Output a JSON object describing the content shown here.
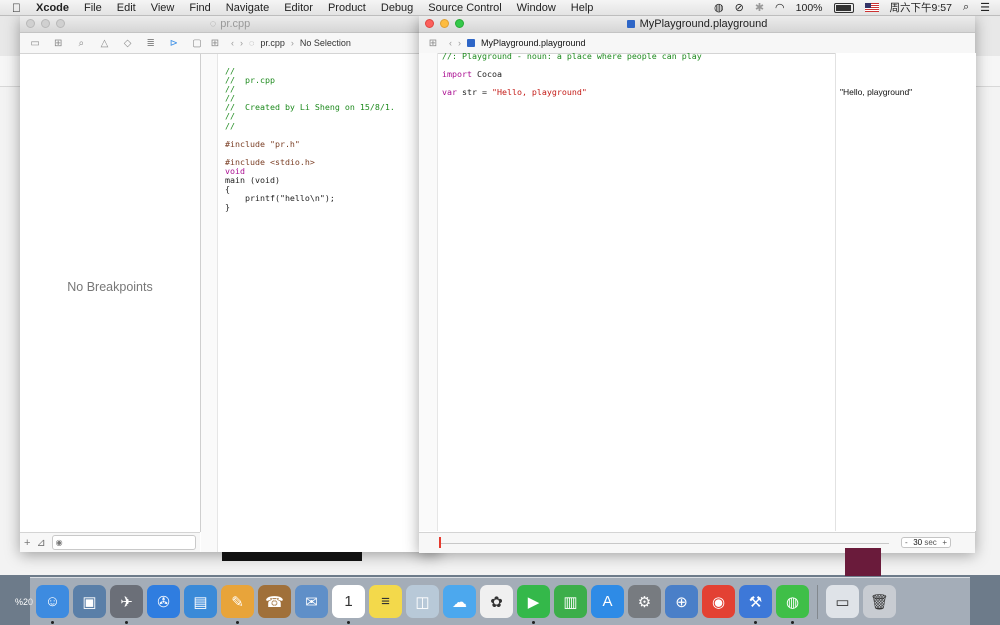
{
  "menubar": {
    "app": "Xcode",
    "items": [
      "File",
      "Edit",
      "View",
      "Find",
      "Navigate",
      "Editor",
      "Product",
      "Debug",
      "Source Control",
      "Window",
      "Help"
    ],
    "battery": "100%",
    "clock": "周六下午9:57"
  },
  "back_window": {
    "title": "pr.cpp",
    "navigator_empty": "No Breakpoints",
    "jump_file": "pr.cpp",
    "jump_selection": "No Selection",
    "code": [
      {
        "cls": "cm",
        "text": "//"
      },
      {
        "cls": "cm",
        "text": "//  pr.cpp"
      },
      {
        "cls": "cm",
        "text": "//"
      },
      {
        "cls": "cm",
        "text": "//"
      },
      {
        "cls": "cm",
        "text": "//  Created by Li Sheng on 15/8/1."
      },
      {
        "cls": "cm",
        "text": "//"
      },
      {
        "cls": "cm",
        "text": "//"
      },
      {
        "cls": "",
        "text": ""
      },
      {
        "cls": "pp",
        "text": "#include \"pr.h\""
      },
      {
        "cls": "",
        "text": ""
      },
      {
        "cls": "pp",
        "text": "#include <stdio.h>"
      },
      {
        "cls": "kw",
        "text": "void"
      },
      {
        "cls": "",
        "text": "main (void)"
      },
      {
        "cls": "",
        "text": "{"
      },
      {
        "cls": "",
        "text": "    printf(\"hello\\n\");"
      },
      {
        "cls": "",
        "text": "}"
      }
    ]
  },
  "front_window": {
    "title": "MyPlayground.playground",
    "jump_file": "MyPlayground.playground",
    "code": [
      {
        "cls": "cm",
        "text": "//: Playground - noun: a place where people can play"
      },
      {
        "cls": "",
        "text": ""
      },
      {
        "cls": "",
        "text": "import Cocoa"
      },
      {
        "cls": "",
        "text": ""
      },
      {
        "cls": "",
        "text": "var str = \"Hello, playground\""
      }
    ],
    "result": "\"Hello, playground\"",
    "timeline": {
      "minus": "-",
      "value": "30",
      "unit": "sec",
      "plus": "+"
    }
  },
  "desktop": {
    "side_label": "%20"
  },
  "dock": {
    "apps": [
      {
        "name": "finder",
        "color": "#3d8be0",
        "glyph": "☺"
      },
      {
        "name": "preview",
        "color": "#5a7fa8",
        "glyph": "▣"
      },
      {
        "name": "launchpad",
        "color": "#6b6f78",
        "glyph": "✈"
      },
      {
        "name": "safari",
        "color": "#2f7de0",
        "glyph": "✇"
      },
      {
        "name": "keynote",
        "color": "#3a8ad8",
        "glyph": "▤"
      },
      {
        "name": "pages",
        "color": "#e8a43a",
        "glyph": "✎"
      },
      {
        "name": "contacts",
        "color": "#a0703a",
        "glyph": "☎"
      },
      {
        "name": "mail",
        "color": "#5f8fc8",
        "glyph": "✉"
      },
      {
        "name": "calendar",
        "color": "#ffffff",
        "glyph": "1"
      },
      {
        "name": "notes",
        "color": "#f3d94b",
        "glyph": "≡"
      },
      {
        "name": "photo-booth",
        "color": "#b8c9d8",
        "glyph": "◫"
      },
      {
        "name": "messages",
        "color": "#4ca8ee",
        "glyph": "☁"
      },
      {
        "name": "photos",
        "color": "#f0f0f0",
        "glyph": "✿"
      },
      {
        "name": "facetime",
        "color": "#34b84a",
        "glyph": "▶"
      },
      {
        "name": "numbers",
        "color": "#3cae4a",
        "glyph": "▥"
      },
      {
        "name": "app-store",
        "color": "#2e8be6",
        "glyph": "A"
      },
      {
        "name": "system-preferences",
        "color": "#777b80",
        "glyph": "⚙"
      },
      {
        "name": "directory-utility",
        "color": "#4a7fc8",
        "glyph": "⊕"
      },
      {
        "name": "chrome",
        "color": "#e34133",
        "glyph": "◉"
      },
      {
        "name": "xcode",
        "color": "#3d78d8",
        "glyph": "⚒"
      },
      {
        "name": "wechat",
        "color": "#3fbf48",
        "glyph": "◍"
      },
      {
        "name": "downloads",
        "color": "#dfe3e8",
        "glyph": "▭"
      },
      {
        "name": "trash",
        "color": "#c8ccd2",
        "glyph": "🗑"
      }
    ]
  }
}
